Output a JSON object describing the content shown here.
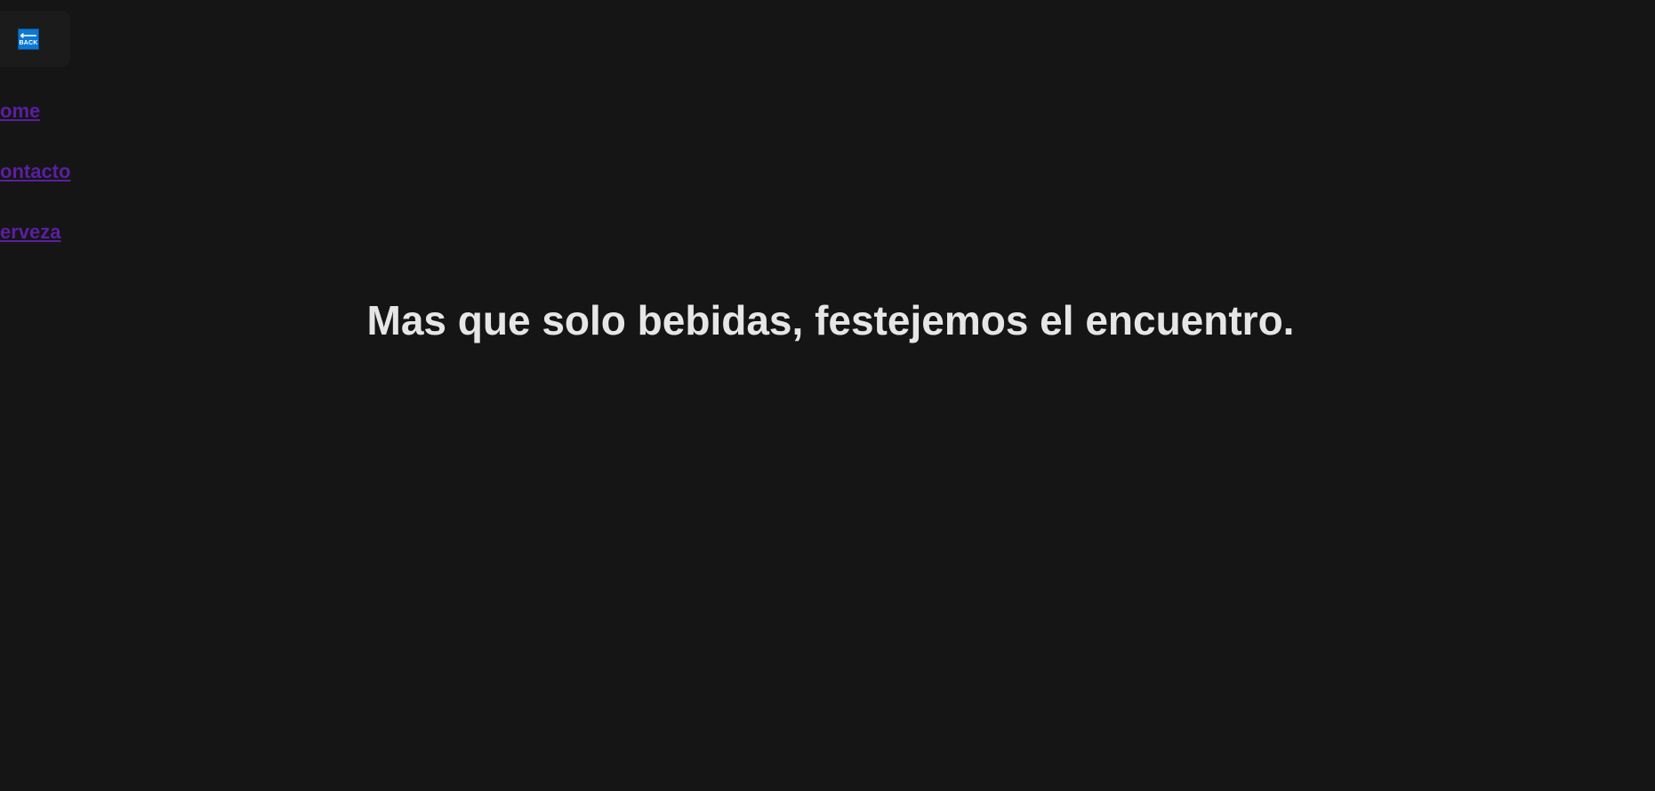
{
  "back_button": {
    "icon": "back-arrow-icon",
    "arrow": "⟵",
    "label": "BACK",
    "color": "#0a78d4"
  },
  "nav": {
    "links": [
      {
        "label": "ome"
      },
      {
        "label": "ontacto"
      },
      {
        "label": "erveza"
      }
    ],
    "link_color": "#5a1fa0"
  },
  "hero": {
    "headline": "Mas que solo bebidas, festejemos el encuentro."
  },
  "colors": {
    "background": "#151515",
    "headline": "#e6e6e6"
  }
}
